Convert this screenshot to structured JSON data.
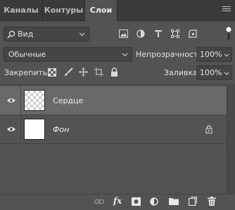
{
  "tabs": [
    {
      "label": "Каналы"
    },
    {
      "label": "Контуры"
    },
    {
      "label": "Слои"
    }
  ],
  "filter": {
    "type_label": "Вид"
  },
  "blend": {
    "mode": "Обычные",
    "opacity_label": "Непрозрачность:",
    "opacity_value": "100%"
  },
  "lock": {
    "label": "Закрепить:",
    "fill_label": "Заливка:",
    "fill_value": "100%"
  },
  "layers": [
    {
      "name": "Сердце",
      "selected": true,
      "transparent": true,
      "locked": false
    },
    {
      "name": "Фон",
      "selected": false,
      "transparent": false,
      "locked": true
    }
  ],
  "colors": {
    "panel_bg": "#535353",
    "tabbar_bg": "#3b3b3b",
    "selected_row": "#696969",
    "field_bg": "#454545"
  },
  "icons": {
    "filter_search": "search-icon",
    "filter_pixel": "image-icon",
    "filter_adjust": "adjustment-icon",
    "filter_text": "text-icon",
    "filter_shape": "shape-icon",
    "filter_smart": "smart-object-icon",
    "lock_pixels": "lock-transparent-icon",
    "lock_brush": "brush-icon",
    "lock_move": "move-icon",
    "lock_artboard": "artboard-icon",
    "lock_all": "lock-icon",
    "bottom_link": "link-icon",
    "bottom_fx": "fx-icon",
    "bottom_mask": "mask-icon",
    "bottom_adjust": "adjustment-layer-icon",
    "bottom_group": "folder-icon",
    "bottom_new": "new-layer-icon",
    "bottom_delete": "trash-icon"
  }
}
